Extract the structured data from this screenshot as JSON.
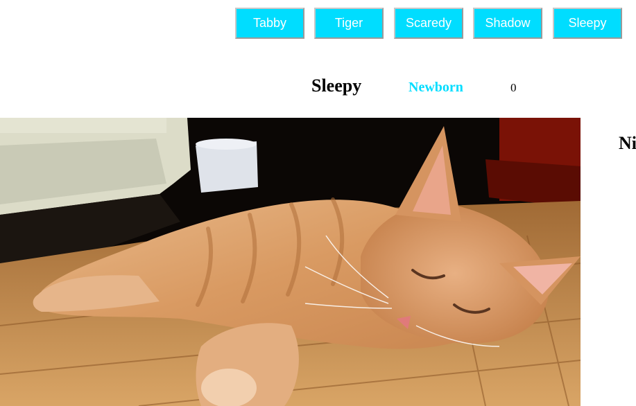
{
  "nav": {
    "buttons": [
      {
        "label": "Tabby"
      },
      {
        "label": "Tiger"
      },
      {
        "label": "Scaredy"
      },
      {
        "label": "Shadow"
      },
      {
        "label": "Sleepy"
      }
    ]
  },
  "cat": {
    "name": "Sleepy",
    "stage": "Newborn",
    "click_count": "0",
    "image_alt": "Orange tabby kitten sleeping on a wooden floor"
  },
  "next_cat": {
    "name_partial": "Ni"
  },
  "colors": {
    "accent": "#00ddff",
    "button_text": "#ffffff"
  }
}
